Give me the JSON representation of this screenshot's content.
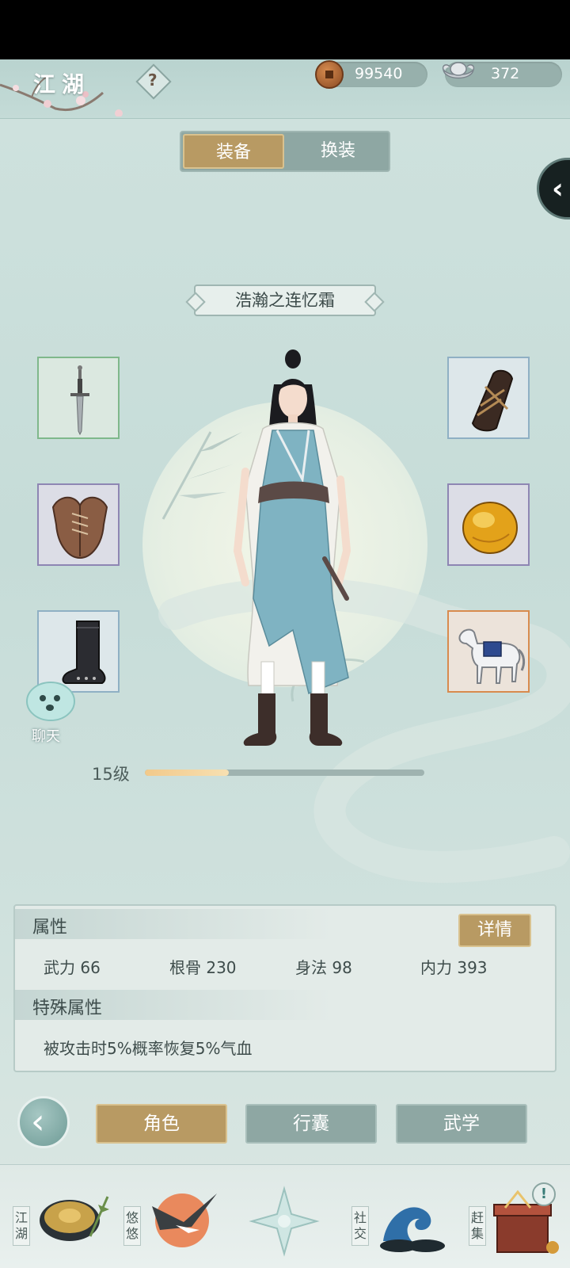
{
  "header": {
    "title": "江湖",
    "help_symbol": "?",
    "copper": "99540",
    "silver": "372"
  },
  "segment": {
    "equip": "装备",
    "outfit": "换装"
  },
  "side_tab_glyph": "‹",
  "character": {
    "name": "浩瀚之连忆霜"
  },
  "chat_label": "聊天",
  "level": {
    "label": "15级",
    "progress": 0.3
  },
  "attributes": {
    "heading": "属性",
    "detail_button": "详情",
    "stats": [
      {
        "text": "武力 66"
      },
      {
        "text": "根骨 230"
      },
      {
        "text": "身法 98"
      },
      {
        "text": "内力 393"
      }
    ],
    "special_heading": "特殊属性",
    "special_text": "被攻击时5%概率恢复5%气血"
  },
  "tabs": [
    "角色",
    "行囊",
    "武学"
  ],
  "back_glyph": "‹",
  "bottom_nav": [
    {
      "label": "江湖",
      "icon": "straw-hat-icon"
    },
    {
      "label": "悠悠",
      "icon": "crane-icon"
    },
    {
      "label": "",
      "icon": "compass-star-icon"
    },
    {
      "label": "社交",
      "icon": "wave-icon"
    },
    {
      "label": "赶集",
      "icon": "treasure-chest-icon"
    }
  ],
  "colors": {
    "gold_button": "#b89a63",
    "teal_background": "#c9ddd9",
    "slot_green": "#7fb88b",
    "slot_blue": "#8fb0c4",
    "slot_purple": "#8e86b3",
    "slot_orange": "#d88b4e"
  }
}
